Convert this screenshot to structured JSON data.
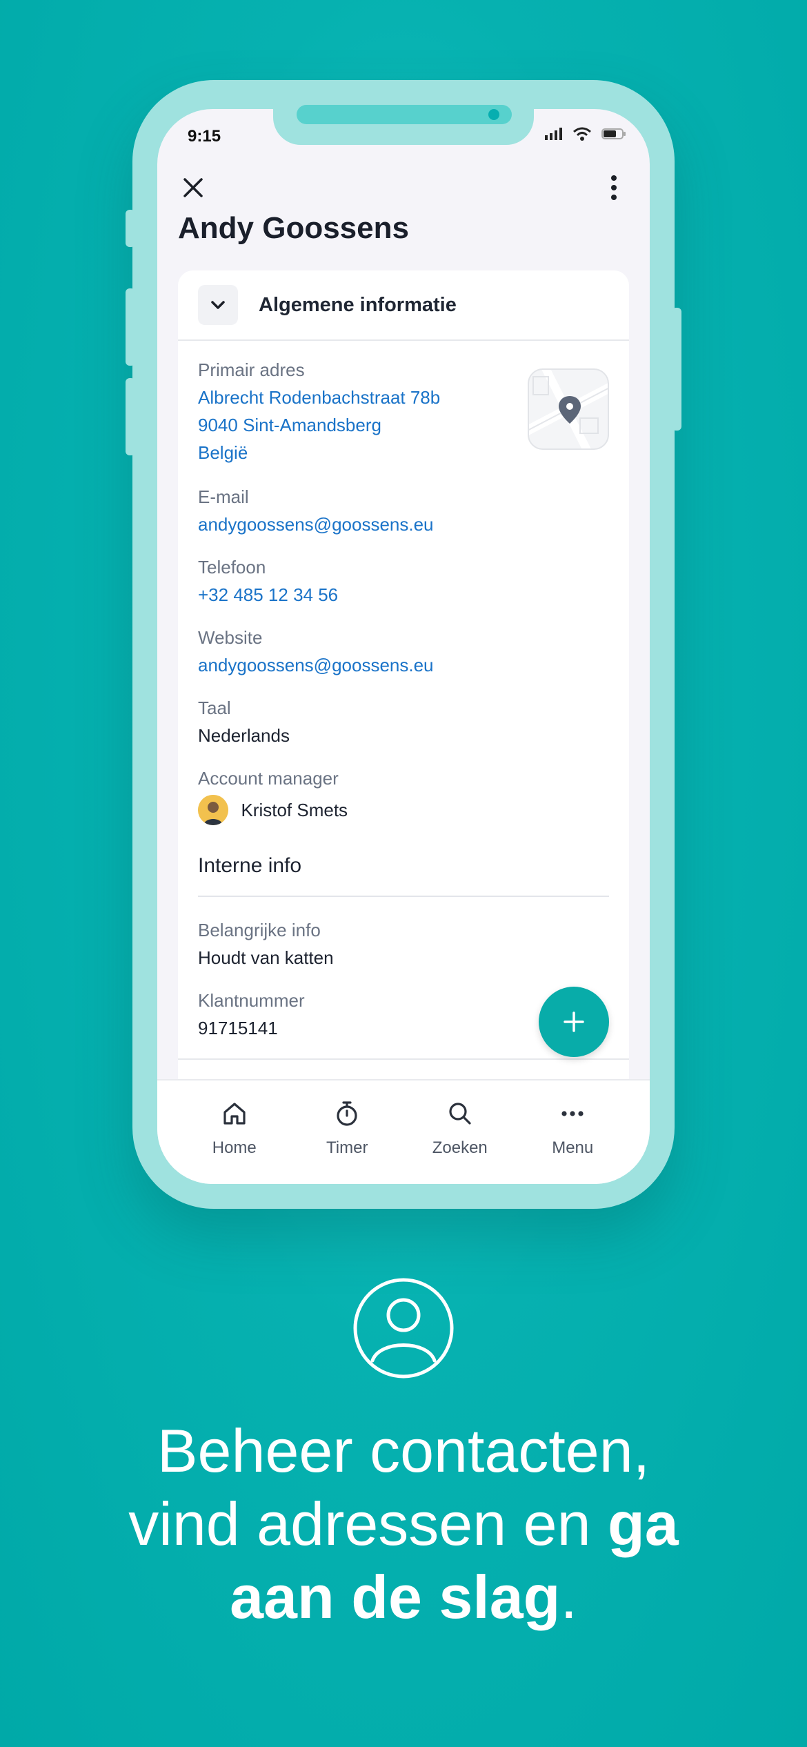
{
  "status": {
    "time": "9:15"
  },
  "contact": {
    "name": "Andy Goossens"
  },
  "card": {
    "title": "Algemene informatie",
    "fields": {
      "address": {
        "label": "Primair adres",
        "line1": "Albrecht Rodenbachstraat 78b",
        "line2": "9040 Sint-Amandsberg",
        "line3": "België"
      },
      "email": {
        "label": "E-mail",
        "value": "andygoossens@goossens.eu"
      },
      "phone": {
        "label": "Telefoon",
        "value": "+32 485 12 34 56"
      },
      "website": {
        "label": "Website",
        "value": "andygoossens@goossens.eu"
      },
      "language": {
        "label": "Taal",
        "value": "Nederlands"
      },
      "manager": {
        "label": "Account manager",
        "value": "Kristof Smets"
      }
    },
    "internal": {
      "title": "Interne info",
      "important": {
        "label": "Belangrijke info",
        "value": "Houdt van katten"
      },
      "customer_number": {
        "label": "Klantnummer",
        "value": "91715141"
      }
    }
  },
  "tabs": [
    {
      "label": "Home",
      "icon": "home-icon"
    },
    {
      "label": "Timer",
      "icon": "stopwatch-icon"
    },
    {
      "label": "Zoeken",
      "icon": "search-icon"
    },
    {
      "label": "Menu",
      "icon": "more-horizontal-icon"
    }
  ],
  "tagline": {
    "line1": "Beheer contacten,",
    "line2_regular": "vind adressen en ",
    "line2_bold": "ga",
    "line3_bold": "aan de slag",
    "line3_end": "."
  },
  "colors": {
    "background": "#00a9a8",
    "accent": "#08aca9",
    "link": "#1a73c8",
    "frame": "#9fe2df"
  }
}
